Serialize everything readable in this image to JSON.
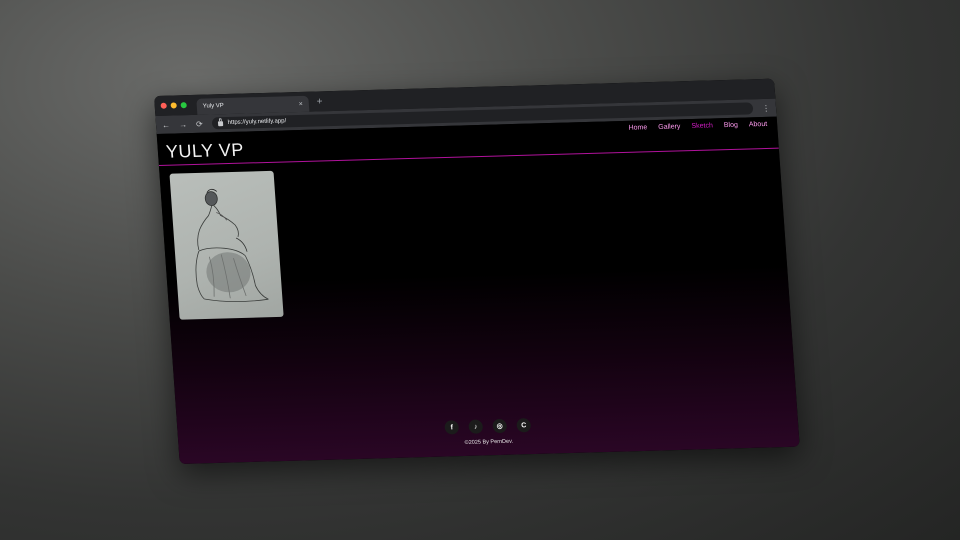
{
  "browser": {
    "tab_title": "Yuly VP",
    "tab_close": "×",
    "new_tab": "+",
    "url": "https://yuly.netlify.app/",
    "back": "←",
    "forward": "→",
    "reload": "⟳",
    "menu": "⋮",
    "dot_colors": [
      "#ff5f57",
      "#febc2e",
      "#28c840"
    ]
  },
  "site": {
    "title": "YULY VP",
    "nav": [
      {
        "label": "Home"
      },
      {
        "label": "Gallery"
      },
      {
        "label": "Sketch"
      },
      {
        "label": "Blog"
      },
      {
        "label": "About"
      }
    ],
    "active_nav": "Sketch",
    "accent": "#d21bc4",
    "footer": {
      "socials": [
        {
          "icon": "facebook-icon",
          "glyph": "f"
        },
        {
          "icon": "tiktok-icon",
          "glyph": "♪"
        },
        {
          "icon": "instagram-icon",
          "glyph": "◎"
        },
        {
          "icon": "c-icon",
          "glyph": "C"
        }
      ],
      "copyright": "©2025 By PernDev."
    }
  }
}
